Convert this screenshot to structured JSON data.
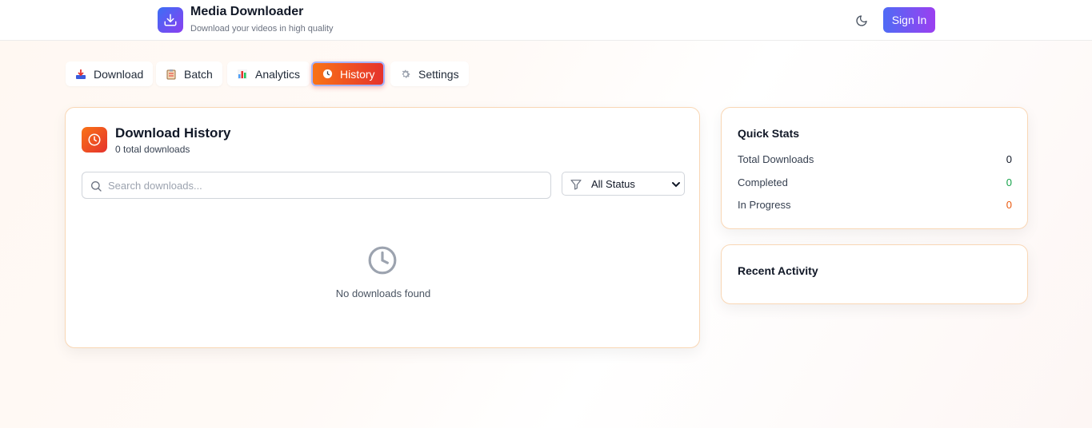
{
  "header": {
    "title": "Media Downloader",
    "subtitle": "Download your videos in high quality",
    "sign_in_label": "Sign In"
  },
  "tabs": [
    {
      "label": "Download",
      "icon": "inbox-tray-icon",
      "active": false
    },
    {
      "label": "Batch",
      "icon": "clipboard-icon",
      "active": false
    },
    {
      "label": "Analytics",
      "icon": "bar-chart-icon",
      "active": false
    },
    {
      "label": "History",
      "icon": "clock-icon",
      "active": true
    },
    {
      "label": "Settings",
      "icon": "gear-icon",
      "active": false
    }
  ],
  "history": {
    "title": "Download History",
    "count_text": "0 total downloads",
    "search_placeholder": "Search downloads...",
    "status_filter": "All Status",
    "empty_text": "No downloads found"
  },
  "quick_stats": {
    "title": "Quick Stats",
    "rows": [
      {
        "label": "Total Downloads",
        "value": "0",
        "color": "#111827"
      },
      {
        "label": "Completed",
        "value": "0",
        "color": "#16a34a"
      },
      {
        "label": "In Progress",
        "value": "0",
        "color": "#ea580c"
      }
    ]
  },
  "recent_activity": {
    "title": "Recent Activity"
  },
  "colors": {
    "brand_gradient_start": "#3b6ff5",
    "brand_gradient_end": "#8b3ff0",
    "active_tab_start": "#f97316",
    "active_tab_end": "#e5322d"
  }
}
